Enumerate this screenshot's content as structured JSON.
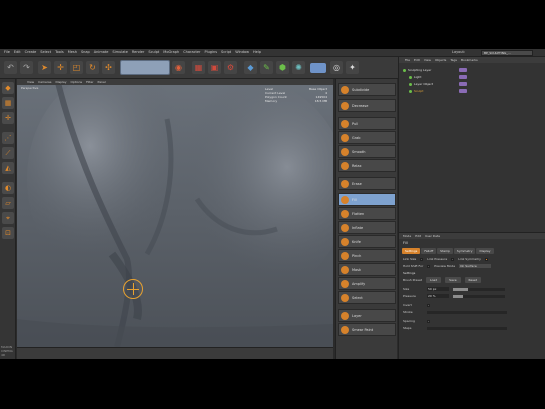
{
  "menubar": {
    "items": [
      "File",
      "Edit",
      "Create",
      "Select",
      "Tools",
      "Mesh",
      "Snap",
      "Animate",
      "Simulate",
      "Render",
      "Sculpt",
      "MoGraph",
      "Character",
      "Plugins",
      "Script",
      "Window",
      "Help"
    ],
    "layout_label": "Layout:",
    "layout_value": "BP_SCULPTING_..."
  },
  "toolbar": {
    "icons": [
      "undo-icon",
      "pointer-icon",
      "move-icon",
      "scale-icon",
      "rotate-icon",
      "render-icon"
    ]
  },
  "viewport": {
    "menu": [
      "View",
      "Cameras",
      "Display",
      "Options",
      "Filter",
      "Panel"
    ],
    "label": "Perspective",
    "stats": [
      {
        "k": "Level",
        "v": "Base Object"
      },
      {
        "k": "Current Level",
        "v": "4"
      },
      {
        "k": "Polygon Count",
        "v": "149504"
      },
      {
        "k": "Memory",
        "v": "18.5 MB"
      }
    ],
    "colors": {
      "mesh": "#5b6169",
      "brush": "#e8a230"
    }
  },
  "lefttools": {
    "logo": "MAXON CINEMA 4D"
  },
  "brushlist": {
    "items": [
      {
        "label": "Subdivide",
        "active": false
      },
      {
        "label": "Decrease",
        "active": false
      },
      {
        "label": "Pull",
        "active": false
      },
      {
        "label": "Grab",
        "active": false
      },
      {
        "label": "Smooth",
        "active": false
      },
      {
        "label": "Relax",
        "active": false
      },
      {
        "label": "Erase",
        "active": false
      },
      {
        "label": "Fill",
        "active": true
      },
      {
        "label": "Flatten",
        "active": false
      },
      {
        "label": "Inflate",
        "active": false
      },
      {
        "label": "Knife",
        "active": false
      },
      {
        "label": "Pinch",
        "active": false
      },
      {
        "label": "Mask",
        "active": false
      },
      {
        "label": "Amplify",
        "active": false
      },
      {
        "label": "Select",
        "active": false
      },
      {
        "label": "Layer",
        "active": false
      },
      {
        "label": "Smear Paint",
        "active": false
      }
    ]
  },
  "objects": {
    "tabs": [
      "File",
      "Edit",
      "View",
      "Objects",
      "Tags",
      "Bookmarks"
    ],
    "rows": [
      {
        "label": "Sculpting Layer",
        "selected": false
      },
      {
        "label": "Light",
        "selected": false
      },
      {
        "label": "Layer Object",
        "selected": false
      },
      {
        "label": "Sculpt",
        "selected": true
      }
    ]
  },
  "attributes": {
    "modes": [
      "Mode",
      "Edit",
      "User Data"
    ],
    "title": "Fill",
    "tabs": [
      {
        "label": "Settings",
        "on": true
      },
      {
        "label": "Falloff",
        "on": false
      },
      {
        "label": "Stamp",
        "on": false
      },
      {
        "label": "Symmetry",
        "on": false
      },
      {
        "label": "Display",
        "on": false
      }
    ],
    "opts": {
      "link_size": "Link Size",
      "link_pressure": "Link Pressure",
      "link_symmetry": "Link Symmetry",
      "hold_shift": "Hold Shift For",
      "preview_mode": "Preview Mode",
      "preview_value": "On Surface"
    },
    "settings_header": "Settings",
    "brush_preset": "Brush Preset",
    "buttons": [
      "Load",
      "Save",
      "Reset"
    ],
    "size_label": "Size",
    "size_value": "50 px",
    "size_fill": 0.28,
    "pressure_label": "Pressure",
    "pressure_value": "20 %",
    "pressure_fill": 0.2,
    "invert_label": "Invert",
    "stroke_label": "Stroke",
    "spacing_label": "Spacing",
    "steps_label": "Steps"
  }
}
